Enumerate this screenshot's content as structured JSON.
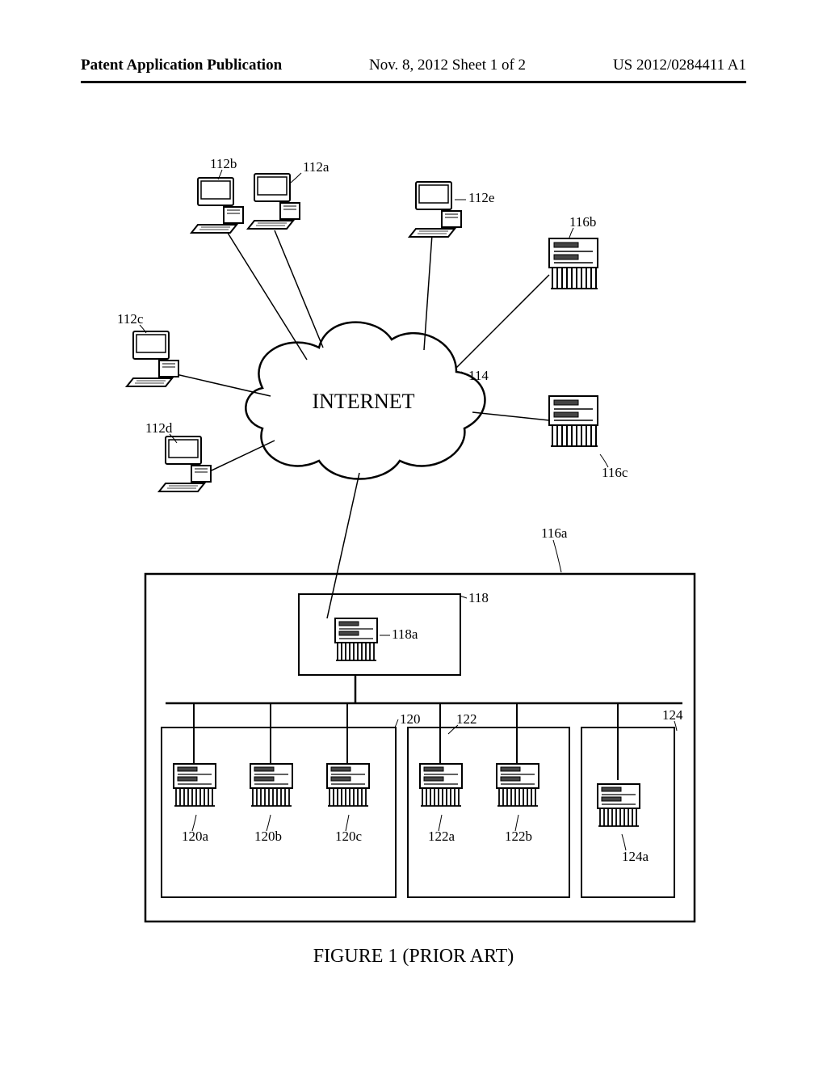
{
  "header": {
    "left": "Patent Application Publication",
    "center": "Nov. 8, 2012  Sheet 1 of 2",
    "right": "US 2012/0284411 A1"
  },
  "diagram": {
    "cloud_label": "INTERNET",
    "caption": "FIGURE 1 (PRIOR ART)",
    "refs": {
      "pc_112a": "112a",
      "pc_112b": "112b",
      "pc_112c": "112c",
      "pc_112d": "112d",
      "pc_112e": "112e",
      "cloud_114": "114",
      "srv_116a": "116a",
      "srv_116b": "116b",
      "srv_116c": "116c",
      "box_118": "118",
      "srv_118a": "118a",
      "box_120": "120",
      "srv_120a": "120a",
      "srv_120b": "120b",
      "srv_120c": "120c",
      "box_122": "122",
      "srv_122a": "122a",
      "srv_122b": "122b",
      "box_124": "124",
      "srv_124a": "124a"
    }
  }
}
